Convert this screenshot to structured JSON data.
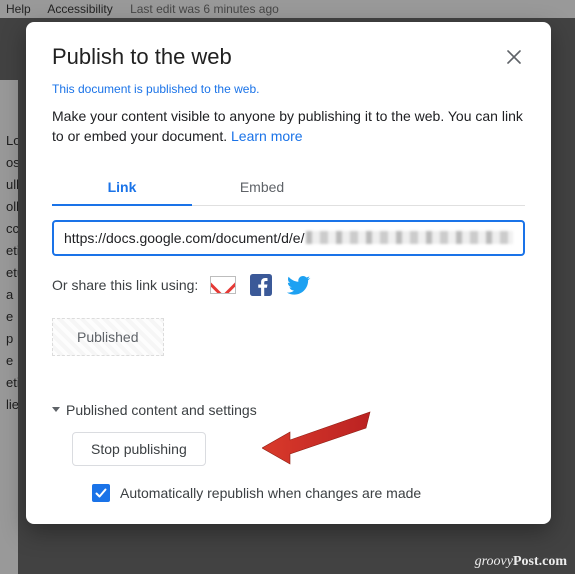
{
  "background": {
    "menu": {
      "help": "Help",
      "accessibility": "Accessibility",
      "last_edit": "Last edit was 6 minutes ago"
    },
    "partial_words": [
      "Lo",
      "os",
      "ull",
      "olla",
      "cc",
      "eti",
      "etu",
      " ",
      "a",
      "e",
      "p",
      "e",
      "eti",
      "lie"
    ]
  },
  "dialog": {
    "title": "Publish to the web",
    "close_label": "Close",
    "status": "This document is published to the web.",
    "description": "Make your content visible to anyone by publishing it to the web. You can link to or embed your document. ",
    "learn_more": "Learn more",
    "tabs": {
      "link": "Link",
      "embed": "Embed",
      "active": "link"
    },
    "url": {
      "visible": "https://docs.google.com/document/d/e/"
    },
    "share": {
      "label": "Or share this link using:",
      "gmail": "gmail-icon",
      "facebook": "facebook-icon",
      "twitter": "twitter-icon"
    },
    "published_badge": "Published",
    "expander": "Published content and settings",
    "stop_button": "Stop publishing",
    "auto_republish": "Automatically republish when changes are made",
    "auto_republish_checked": true
  },
  "arrow": {
    "color": "#d93a2b"
  },
  "watermark": {
    "prefix": "groovy",
    "suffix": "Post.com"
  }
}
